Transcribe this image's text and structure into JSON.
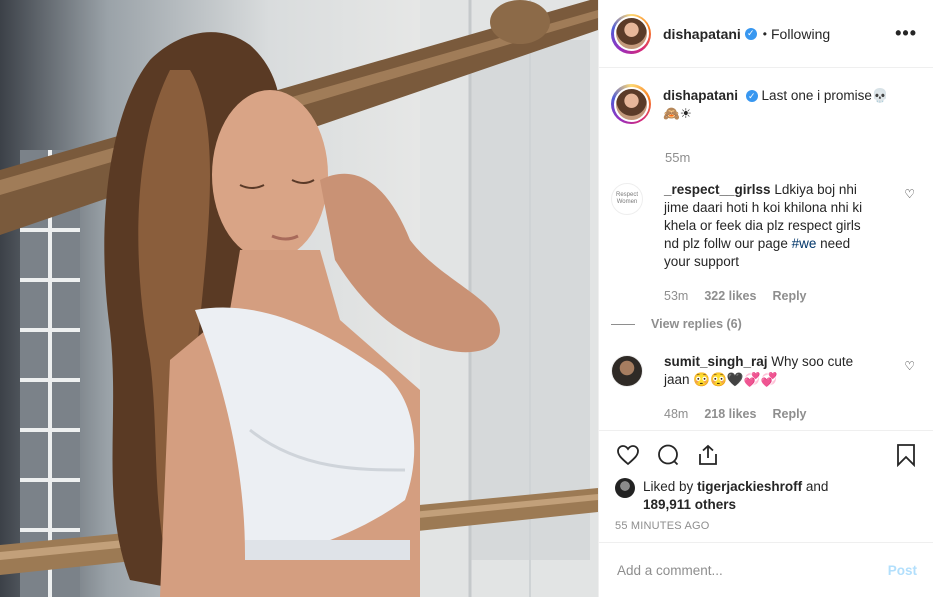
{
  "header": {
    "username": "dishapatani",
    "verified_glyph": "✓",
    "separator": "•",
    "follow_status": "Following",
    "more_icon": "•••"
  },
  "caption": {
    "username": "dishapatani",
    "text": "Last one i promise💀🙈☀",
    "time": "55m"
  },
  "comments": [
    {
      "avatar_text": "Respect Women",
      "username": "_respect__girlss",
      "text_before": "Ldkiya boj nhi jime daari hoti h koi khilona nhi ki khela or feek dia plz respect girls nd plz follw our page",
      "hashtag": "#we",
      "text_after": "need your support",
      "time": "53m",
      "likes": "322 likes",
      "reply_label": "Reply",
      "view_replies": "View replies (6)"
    },
    {
      "username": "sumit_singh_raj",
      "text": "Why soo cute jaan 😳😳🖤💞💞",
      "time": "48m",
      "likes": "218 likes",
      "reply_label": "Reply"
    }
  ],
  "likes": {
    "prefix": "Liked by",
    "user": "tigerjackieshroff",
    "conj": "and",
    "count": "189,911 others"
  },
  "timestamp": "55 MINUTES AGO",
  "add_comment": {
    "placeholder": "Add a comment...",
    "post_label": "Post"
  },
  "icons": [
    "heart-icon",
    "comment-icon",
    "share-icon",
    "bookmark-icon"
  ],
  "colors": {
    "link_blue": "#3897f0",
    "post_disabled": "#b2dffc",
    "muted_text": "#8e8e8e"
  }
}
